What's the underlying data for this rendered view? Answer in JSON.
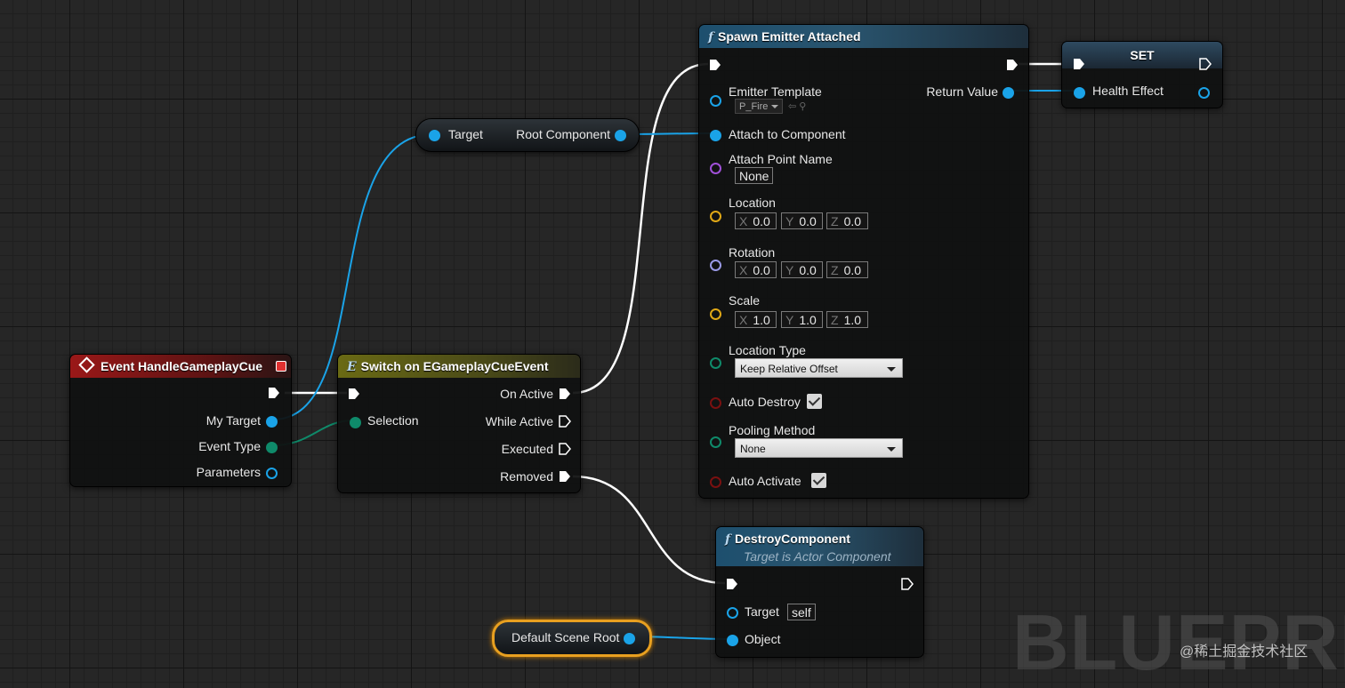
{
  "colors": {
    "exec": "#ffffff",
    "object_wire": "#1aa3e8",
    "enum_wire": "#0f8a6a",
    "event_header": "#9a1818",
    "switch_header": "#6a6a14",
    "function_header": "#1d4f6e"
  },
  "event_node": {
    "title": "Event HandleGameplayCue",
    "icon": "event-diamond-icon",
    "pins": {
      "my_target": "My Target",
      "event_type": "Event Type",
      "parameters": "Parameters"
    }
  },
  "switch_node": {
    "title": "Switch on EGameplayCueEvent",
    "icon": "enum-switch-icon",
    "selection": "Selection",
    "outputs": {
      "on_active": "On Active",
      "while_active": "While Active",
      "executed": "Executed",
      "removed": "Removed"
    }
  },
  "get_root_node": {
    "target": "Target",
    "output": "Root Component"
  },
  "spawn_node": {
    "title": "Spawn Emitter Attached",
    "emitter_template": {
      "label": "Emitter Template",
      "value": "P_Fire"
    },
    "return_value": "Return Value",
    "attach_to_component": "Attach to Component",
    "attach_point_name": {
      "label": "Attach Point Name",
      "value": "None"
    },
    "location": {
      "label": "Location",
      "x": "0.0",
      "y": "0.0",
      "z": "0.0"
    },
    "rotation": {
      "label": "Rotation",
      "x": "0.0",
      "y": "0.0",
      "z": "0.0"
    },
    "scale": {
      "label": "Scale",
      "x": "1.0",
      "y": "1.0",
      "z": "1.0"
    },
    "axis_labels": {
      "x": "X",
      "y": "Y",
      "z": "Z"
    },
    "location_type": {
      "label": "Location Type",
      "value": "Keep Relative Offset"
    },
    "auto_destroy": {
      "label": "Auto Destroy",
      "checked": true
    },
    "pooling_method": {
      "label": "Pooling Method",
      "value": "None"
    },
    "auto_activate": {
      "label": "Auto Activate",
      "checked": true
    }
  },
  "set_node": {
    "title": "SET",
    "variable": "Health Effect"
  },
  "destroy_node": {
    "title": "DestroyComponent",
    "subtitle": "Target is Actor Component",
    "target": {
      "label": "Target",
      "value": "self"
    },
    "object": "Object"
  },
  "default_scene_root": {
    "label": "Default Scene Root"
  },
  "watermark": {
    "text": "BLUEPRIN",
    "credit": "@稀土掘金技术社区"
  }
}
